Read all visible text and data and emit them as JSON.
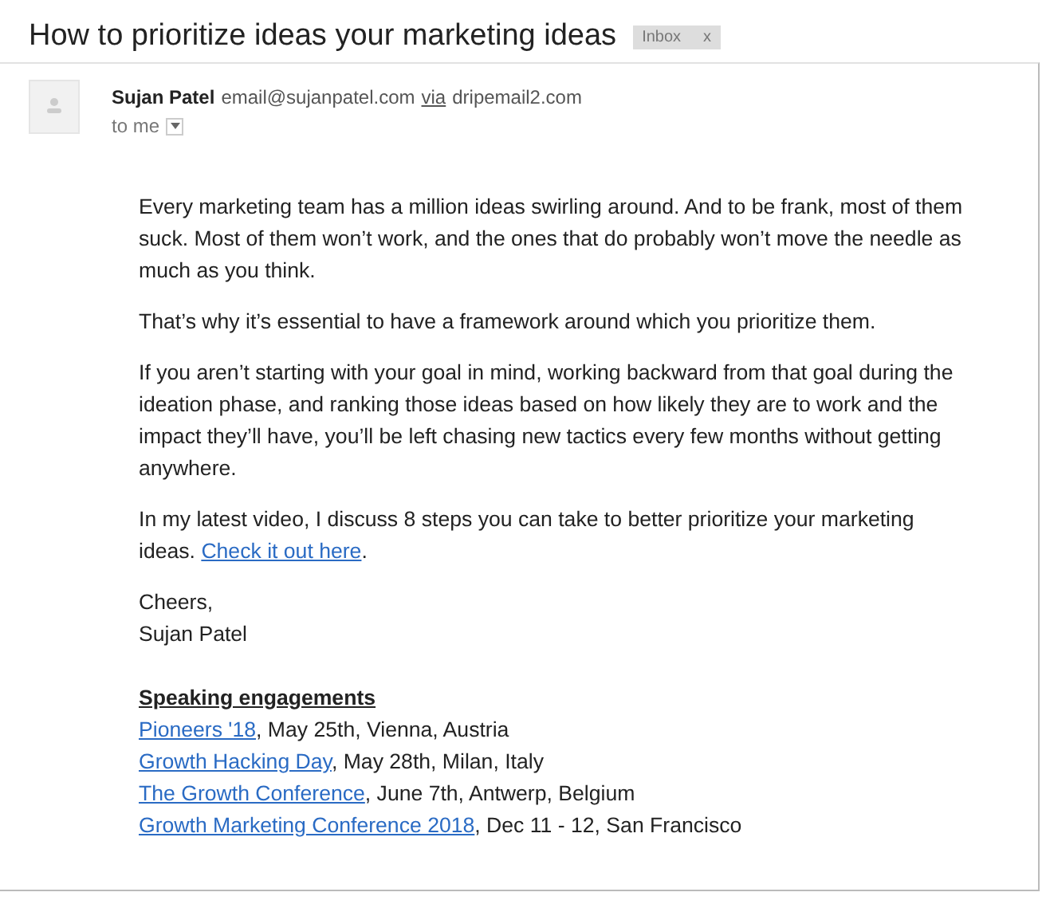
{
  "subject": "How to prioritize ideas your marketing ideas",
  "label": {
    "text": "Inbox",
    "close": "x"
  },
  "sender": {
    "name": "Sujan Patel",
    "email": "email@sujanpatel.com",
    "via": "via",
    "via_domain": "dripemail2.com",
    "to": "to me"
  },
  "paragraphs": [
    {
      "text": "Every marketing team has a million ideas swirling around. And to be frank, most of them suck. Most of them won’t work, and the ones that do probably won’t move the needle as much as you think."
    },
    {
      "text": "That’s why it’s essential to have a framework around which you prioritize them."
    },
    {
      "text": "If you aren’t starting with your goal in mind, working backward from that goal during the ideation phase, and ranking those ideas based on how likely they are to work and the impact they’ll have, you’ll be left chasing new tactics every few months without getting anywhere."
    },
    {
      "text": "In my latest video, I discuss 8 steps you can take to better prioritize your marketing ideas. ",
      "link": "Check it out here",
      "after": "."
    }
  ],
  "signoff": [
    "Cheers,",
    "Sujan Patel"
  ],
  "engagements": {
    "heading": "Speaking engagements",
    "items": [
      {
        "link": "Pioneers '18",
        "details": ", May 25th, Vienna, Austria"
      },
      {
        "link": "Growth Hacking Day",
        "details": ", May 28th, Milan, Italy"
      },
      {
        "link": "The Growth Conference",
        "details": ", June 7th, Antwerp, Belgium"
      },
      {
        "link": "Growth Marketing Conference 2018",
        "details": ", Dec 11 - 12, San Francisco"
      }
    ]
  }
}
